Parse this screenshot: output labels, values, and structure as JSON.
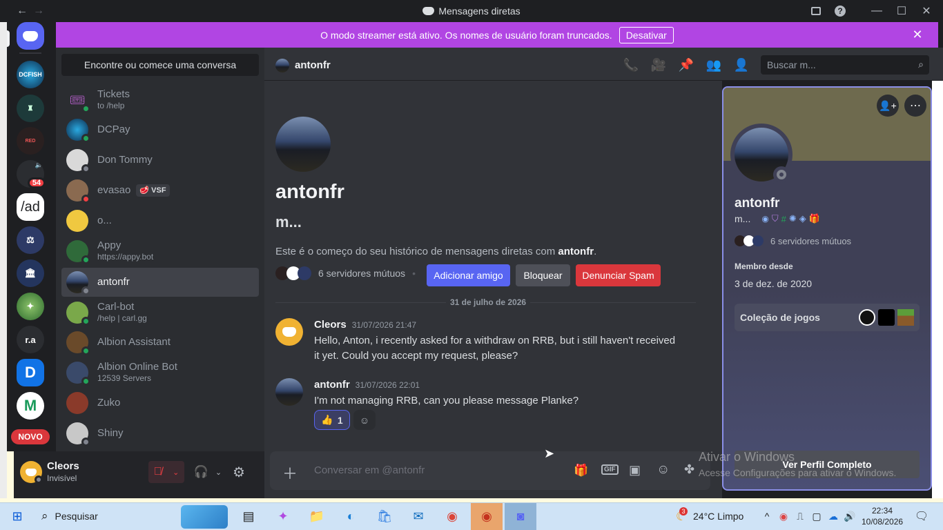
{
  "window": {
    "title": "Mensagens diretas"
  },
  "banner": {
    "text": "O modo streamer está ativo. Os nomes de usuário foram truncados.",
    "button": "Desativar"
  },
  "rail": {
    "badge_count": "54",
    "ra_label": "r.a",
    "novo_label": "NOVO",
    "ad_label": "/ad"
  },
  "dm_list": {
    "find_placeholder": "Encontre ou comece uma conversa",
    "items": [
      {
        "name": "Tickets",
        "sub": "to /help"
      },
      {
        "name": "DCPay",
        "sub": ""
      },
      {
        "name": "Don Tommy",
        "sub": ""
      },
      {
        "name": "evasao",
        "sub": "",
        "tag": "VSF"
      },
      {
        "name": "o...",
        "sub": ""
      },
      {
        "name": "Appy",
        "sub": "https://appy.bot"
      },
      {
        "name": "antonfr",
        "sub": ""
      },
      {
        "name": "Carl-bot",
        "sub": "/help | carl.gg"
      },
      {
        "name": "Albion Assistant",
        "sub": ""
      },
      {
        "name": "Albion Online Bot",
        "sub": "12539 Servers"
      },
      {
        "name": "Zuko",
        "sub": ""
      },
      {
        "name": "Shiny",
        "sub": ""
      }
    ]
  },
  "user_panel": {
    "name": "Cleors",
    "status": "Invisível"
  },
  "chat_header": {
    "name": "antonfr",
    "search_placeholder": "Buscar m..."
  },
  "intro": {
    "display_name": "antonfr",
    "username": "m...",
    "start_text": "Este é o começo do seu histórico de mensagens diretas com ",
    "start_name": "antonfr",
    "start_end": ".",
    "mutual": "6 servidores mútuos",
    "add_friend": "Adicionar amigo",
    "block": "Bloquear",
    "report": "Denunciar Spam"
  },
  "date_divider": "31 de julho de 2026",
  "messages": [
    {
      "author": "Cleors",
      "time": "31/07/2026 21:47",
      "lines": [
        "Hello, Anton, i recently asked for a withdraw on RRB, but i still haven't received",
        "it yet. Could you accept my request, please?"
      ]
    },
    {
      "author": "antonfr",
      "time": "31/07/2026 22:01",
      "lines": [
        "I'm not managing RRB, can you please message Planke?"
      ],
      "reaction": {
        "emoji": "👍",
        "count": "1"
      }
    }
  ],
  "composer": {
    "placeholder": "Conversar em @antonfr"
  },
  "profile": {
    "name": "antonfr",
    "username": "m...",
    "mutual": "6 servidores mútuos",
    "member_since_label": "Membro desde",
    "member_since": "3 de dez. de 2020",
    "games_label": "Coleção de jogos",
    "full_profile": "Ver Perfil Completo"
  },
  "watermark": {
    "line1": "Ativar o Windows",
    "line2": "Acesse Configurações para ativar o Windows."
  },
  "taskbar": {
    "search": "Pesquisar",
    "weather": "24°C  Limpo",
    "weather_badge": "3",
    "time": "22:34",
    "date": "10/08/2026"
  }
}
